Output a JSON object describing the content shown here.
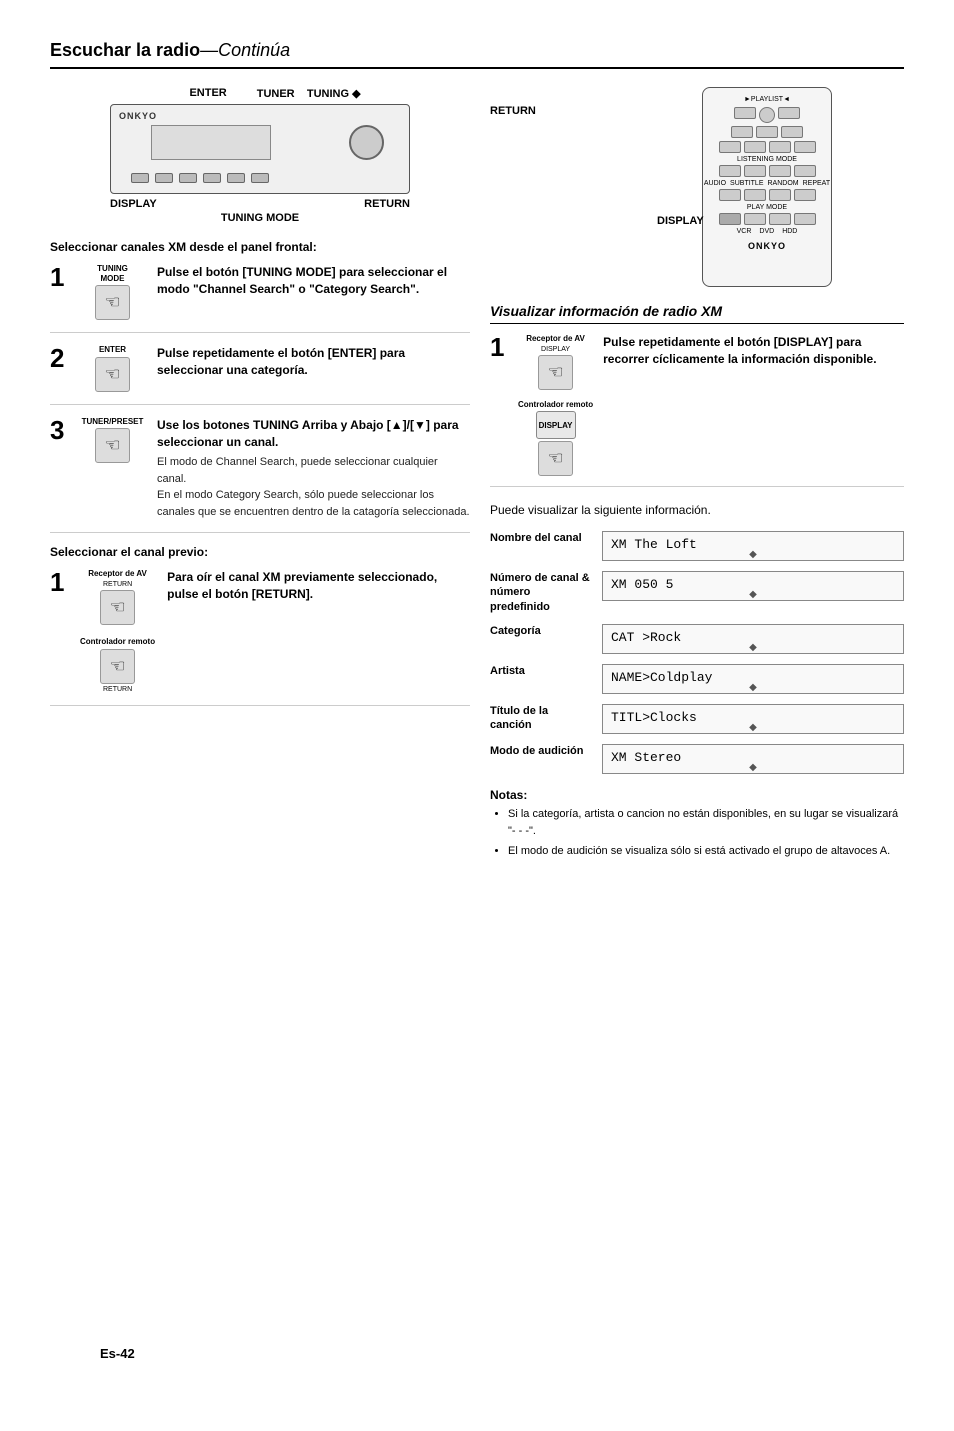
{
  "page": {
    "title": "Escuchar la radio",
    "title_italic": "—Continúa",
    "page_number": "Es-42"
  },
  "top_diagram": {
    "labels_top": [
      "ENTER",
      "TUNER",
      "TUNING ◆"
    ],
    "labels_bottom_left": "DISPLAY",
    "labels_bottom_right": "RETURN",
    "labels_bottom_center": "TUNING MODE"
  },
  "section_xm_front": {
    "header": "Seleccionar canales XM desde el panel frontal:"
  },
  "steps_left": [
    {
      "number": "1",
      "device_label": "TUNING MODE",
      "title": "Pulse el botón [TUNING MODE] para seleccionar el modo \"Channel Search\" o \"Category Search\".",
      "text": ""
    },
    {
      "number": "2",
      "device_label": "ENTER",
      "title": "Pulse repetidamente el botón [ENTER] para seleccionar una categoría.",
      "text": ""
    },
    {
      "number": "3",
      "device_label": "TUNER/PRESET",
      "title": "Use los botones TUNING Arriba y Abajo [▲]/[▼] para seleccionar un canal.",
      "text": "El modo de Channel Search, puede seleccionar cualquier canal.\nEn el modo Category Search, sólo puede seleccionar los canales que se encuentren dentro de la catagoría seleccionada."
    }
  ],
  "section_prev_channel": {
    "header": "Seleccionar el canal previo:"
  },
  "steps_prev": [
    {
      "number": "1",
      "receptor_label": "Receptor de AV",
      "receptor_btn": "RETURN",
      "controlador_label": "Controlador remoto",
      "control_btn": "RETURN",
      "title": "Para oír el canal XM previamente seleccionado, pulse el botón [RETURN].",
      "text": ""
    }
  ],
  "right_col": {
    "return_label": "RETURN",
    "display_label": "DISPLAY",
    "xm_section": {
      "title": "Visualizar información de radio XM",
      "step_1": {
        "number": "1",
        "receptor_label": "Receptor de AV",
        "display_btn": "DISPLAY",
        "controlador_label": "Controlador remoto",
        "display_btn2": "DISPLAY",
        "title": "Pulse repetidamente el botón [DISPLAY] para recorrer cíclicamente la información disponible."
      }
    },
    "info_intro": "Puede visualizar la siguiente información.",
    "info_rows": [
      {
        "label": "Nombre del canal",
        "value": "XM  The Loft"
      },
      {
        "label": "Número de canal & número predefinido",
        "value": "XM       050  5"
      },
      {
        "label": "Categoría",
        "value": "CAT >Rock"
      },
      {
        "label": "Artista",
        "value": "NAME>Coldplay"
      },
      {
        "label": "Título de la canción",
        "value": "TITL>Clocks"
      },
      {
        "label": "Modo de audición",
        "value": "XM  Stereo"
      }
    ],
    "notes": {
      "title": "Notas:",
      "items": [
        "Si la categoría, artista o cancion no están disponibles, en su lugar se visualizará \"- - -\".",
        "El modo de audición se visualiza sólo si está activado el grupo de altavoces A."
      ]
    }
  }
}
